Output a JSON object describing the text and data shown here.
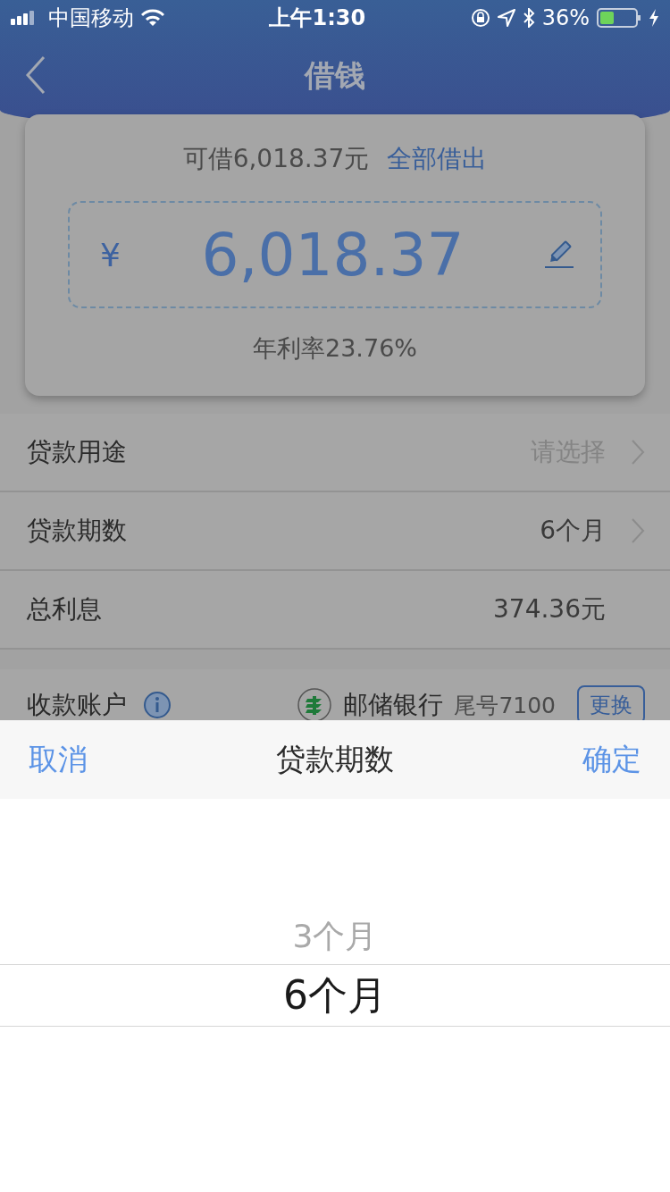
{
  "status_bar": {
    "carrier": "中国移动",
    "time": "上午1:30",
    "battery": "36%"
  },
  "nav": {
    "title": "借钱"
  },
  "loan_card": {
    "available": "可借6,018.37元",
    "borrow_all": "全部借出",
    "currency": "¥",
    "amount": "6,018.37",
    "rate": "年利率23.76%"
  },
  "rows": [
    {
      "label": "贷款用途",
      "placeholder": "请选择",
      "chevron": true
    },
    {
      "label": "贷款期数",
      "value": "6个月",
      "chevron": true
    },
    {
      "label": "总利息",
      "value": "374.36元",
      "chevron": false
    }
  ],
  "account": {
    "label": "收款账户",
    "bank": "邮储银行",
    "tail": "尾号7100",
    "change": "更换"
  },
  "picker": {
    "cancel": "取消",
    "title": "贷款期数",
    "confirm": "确定",
    "options": [
      {
        "label": "3个月",
        "selected": false
      },
      {
        "label": "6个月",
        "selected": true
      }
    ]
  }
}
